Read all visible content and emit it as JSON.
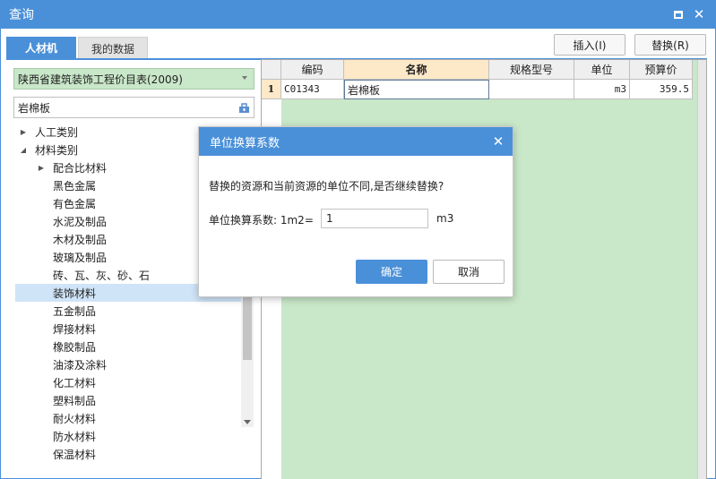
{
  "window": {
    "title": "查询"
  },
  "tabs": [
    {
      "label": "人材机",
      "active": true
    },
    {
      "label": "我的数据",
      "active": false
    }
  ],
  "toolbar": {
    "insert_label": "插入(I)",
    "replace_label": "替换(R)"
  },
  "left_panel": {
    "library_select": "陕西省建筑装饰工程价目表(2009)",
    "search_value": "岩棉板",
    "tree": [
      {
        "label": "人工类别",
        "level": 0,
        "expandable": true,
        "expanded": false
      },
      {
        "label": "材料类别",
        "level": 0,
        "expandable": true,
        "expanded": true
      },
      {
        "label": "配合比材料",
        "level": 1,
        "expandable": true,
        "expanded": false
      },
      {
        "label": "黑色金属",
        "level": 2
      },
      {
        "label": "有色金属",
        "level": 2
      },
      {
        "label": "水泥及制品",
        "level": 2
      },
      {
        "label": "木材及制品",
        "level": 2
      },
      {
        "label": "玻璃及制品",
        "level": 2
      },
      {
        "label": "砖、瓦、灰、砂、石",
        "level": 2
      },
      {
        "label": "装饰材料",
        "level": 2,
        "selected": true
      },
      {
        "label": "五金制品",
        "level": 2
      },
      {
        "label": "焊接材料",
        "level": 2
      },
      {
        "label": "橡胶制品",
        "level": 2
      },
      {
        "label": "油漆及涂料",
        "level": 2
      },
      {
        "label": "化工材料",
        "level": 2
      },
      {
        "label": "塑料制品",
        "level": 2
      },
      {
        "label": "耐火材料",
        "level": 2
      },
      {
        "label": "防水材料",
        "level": 2
      },
      {
        "label": "保温材料",
        "level": 2
      }
    ]
  },
  "grid": {
    "columns": [
      "",
      "编码",
      "名称",
      "规格型号",
      "单位",
      "预算价"
    ],
    "rows": [
      {
        "num": "1",
        "code": "C01343",
        "name": "岩棉板",
        "spec": "",
        "unit": "m3",
        "price": "359.5"
      }
    ]
  },
  "dialog": {
    "title": "单位换算系数",
    "message": "替换的资源和当前资源的单位不同,是否继续替换?",
    "field_label": "单位换算系数: 1m2=",
    "field_value": "1",
    "unit": "m3",
    "ok_label": "确定",
    "cancel_label": "取消"
  },
  "colors": {
    "accent": "#4a90d9",
    "grid_background": "#c9e7c9",
    "selected_tree_item": "#cfe4f7"
  }
}
